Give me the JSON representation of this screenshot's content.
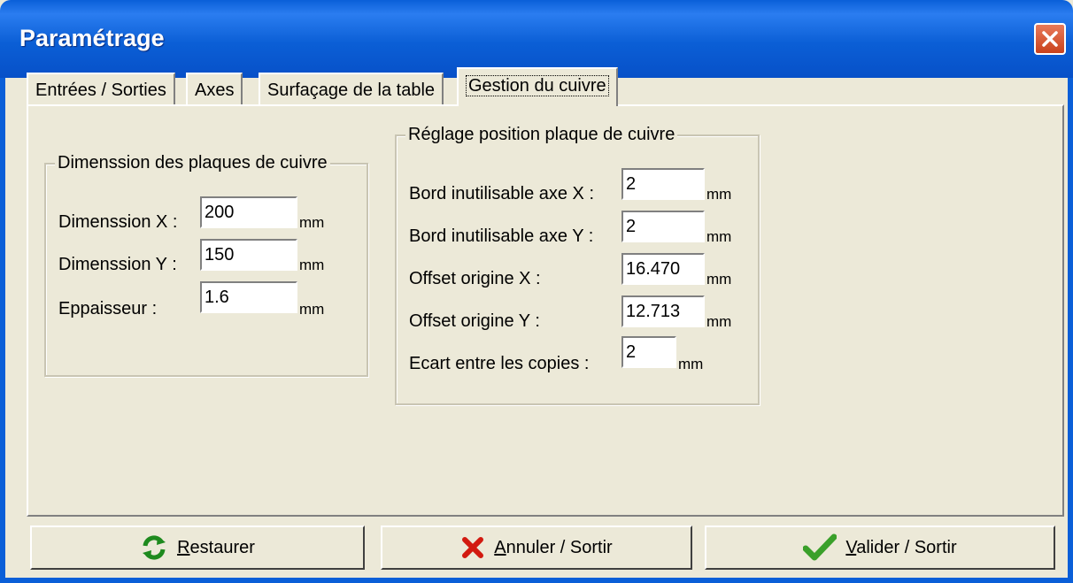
{
  "window": {
    "title": "Paramétrage"
  },
  "tabs": [
    {
      "label": "Entrées / Sorties",
      "active": false
    },
    {
      "label": "Axes",
      "active": false
    },
    {
      "label": "Surfaçage de la table",
      "active": false
    },
    {
      "label": "Gestion du cuivre",
      "active": true
    }
  ],
  "group_dimension": {
    "title": "Dimenssion des plaques de cuivre",
    "fields": [
      {
        "label": "Dimenssion X :",
        "value": "200",
        "unit": "mm"
      },
      {
        "label": "Dimenssion Y :",
        "value": "150",
        "unit": "mm"
      },
      {
        "label": "Eppaisseur :",
        "value": "1.6",
        "unit": "mm"
      }
    ]
  },
  "group_position": {
    "title": "Réglage position plaque de cuivre",
    "fields": [
      {
        "label": "Bord inutilisable axe X :",
        "value": "2",
        "unit": "mm"
      },
      {
        "label": "Bord inutilisable axe Y :",
        "value": "2",
        "unit": "mm"
      },
      {
        "label": "Offset origine X :",
        "value": "16.470",
        "unit": "mm"
      },
      {
        "label": "Offset origine Y :",
        "value": "12.713",
        "unit": "mm"
      },
      {
        "label": "Ecart entre les copies :",
        "value": "2",
        "unit": "mm"
      }
    ]
  },
  "buttons": {
    "restore": {
      "mnemonic": "R",
      "rest": "estaurer",
      "icon": "refresh-icon"
    },
    "cancel": {
      "mnemonic": "A",
      "rest": "nnuler / Sortir",
      "icon": "red-x-icon"
    },
    "validate": {
      "mnemonic": "V",
      "rest": "alider / Sortir",
      "icon": "green-check-icon"
    }
  },
  "colors": {
    "titlebar": "#0a5fd8",
    "dialog_bg": "#ece9d8",
    "close": "#c9421c"
  }
}
